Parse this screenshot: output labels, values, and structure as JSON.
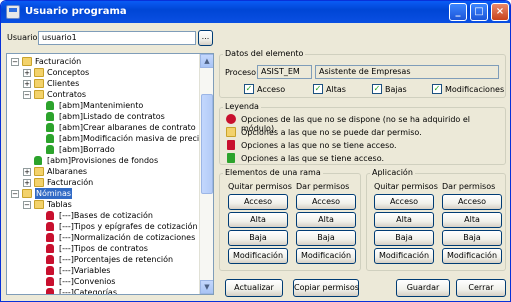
{
  "window": {
    "title": "Usuario programa"
  },
  "user": {
    "label": "Usuario:",
    "value": "usuario1",
    "browse": "..."
  },
  "tree": {
    "items": [
      {
        "label": "Facturación",
        "icon": "folder",
        "level": 0,
        "exp": "−"
      },
      {
        "label": "Conceptos",
        "icon": "folder",
        "level": 1,
        "exp": "+"
      },
      {
        "label": "Clientes",
        "icon": "folder",
        "level": 1,
        "exp": "+"
      },
      {
        "label": "Contratos",
        "icon": "folder",
        "level": 1,
        "exp": "−"
      },
      {
        "label": "[abm]Mantenimiento",
        "icon": "lock-green",
        "level": 2
      },
      {
        "label": "[abm]Listado de contratos",
        "icon": "lock-green",
        "level": 2
      },
      {
        "label": "[abm]Crear albaranes de contrato",
        "icon": "lock-green",
        "level": 2
      },
      {
        "label": "[abm]Modificación masiva de precios",
        "icon": "lock-green",
        "level": 2
      },
      {
        "label": "[abm]Borrado",
        "icon": "lock-green",
        "level": 2
      },
      {
        "label": "[abm]Provisiones de fondos",
        "icon": "lock-green",
        "level": 1
      },
      {
        "label": "Albaranes",
        "icon": "folder",
        "level": 1,
        "exp": "+"
      },
      {
        "label": "Facturación",
        "icon": "folder",
        "level": 1,
        "exp": "+"
      },
      {
        "label": "Nóminas",
        "icon": "folder",
        "level": 0,
        "exp": "−",
        "selected": true
      },
      {
        "label": "Tablas",
        "icon": "folder",
        "level": 1,
        "exp": "−"
      },
      {
        "label": "[---]Bases de cotización",
        "icon": "lock-red",
        "level": 2
      },
      {
        "label": "[---]Tipos y epígrafes de cotización",
        "icon": "lock-red",
        "level": 2
      },
      {
        "label": "[---]Normalización de cotizaciones",
        "icon": "lock-red",
        "level": 2
      },
      {
        "label": "[---]Tipos de contratos",
        "icon": "lock-red",
        "level": 2
      },
      {
        "label": "[---]Porcentajes de retención",
        "icon": "lock-red",
        "level": 2
      },
      {
        "label": "[---]Variables",
        "icon": "lock-red",
        "level": 2
      },
      {
        "label": "[---]Convenios",
        "icon": "lock-red",
        "level": 2
      },
      {
        "label": "[---]Categorías",
        "icon": "lock-red",
        "level": 2
      }
    ]
  },
  "datos": {
    "title": "Datos del elemento",
    "proceso_label": "Proceso:",
    "proceso_code": "ASIST_EM",
    "proceso_name": "Asistente de Empresas",
    "checks": [
      "Acceso",
      "Altas",
      "Bajas",
      "Modificaciones"
    ]
  },
  "leyenda": {
    "title": "Leyenda",
    "items": [
      "Opciones de las que no se dispone (no se ha adquirido el módulo).",
      "Opciones a las que no se puede dar permiso.",
      "Opciones a las que no se tiene acceso.",
      "Opciones a las que se tiene acceso."
    ]
  },
  "rama": {
    "title": "Elementos de una rama",
    "quitar": "Quitar permisos",
    "dar": "Dar permisos"
  },
  "aplicacion": {
    "title": "Aplicación",
    "quitar": "Quitar permisos",
    "dar": "Dar permisos"
  },
  "perm_buttons": [
    "Acceso",
    "Alta",
    "Baja",
    "Modificación"
  ],
  "footer": {
    "actualizar": "Actualizar",
    "copiar": "Copiar permisos",
    "guardar": "Guardar",
    "cerrar": "Cerrar"
  },
  "colors": {
    "titlebar": "#0a5bf5",
    "selection": "#316ac5",
    "lock_green": "#2ca32c",
    "lock_red": "#c8102e"
  }
}
